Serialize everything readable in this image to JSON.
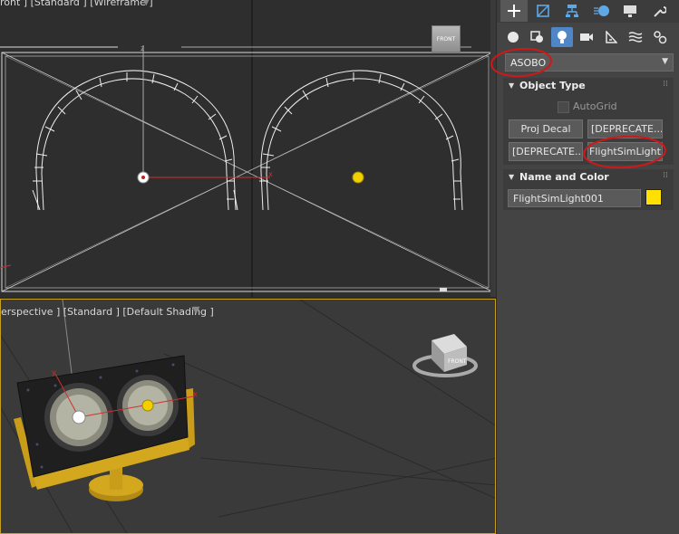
{
  "viewport_top": {
    "label": "ront ] [Standard ] [Wireframe ]",
    "viewcube_label": "FRONT"
  },
  "viewport_bottom": {
    "label": "erspective ] [Standard ] [Default Shading ]",
    "viewcube_label": "FRONT"
  },
  "command_panel": {
    "tabs": [
      "create-icon",
      "modify-icon",
      "hierarchy-icon",
      "motion-icon",
      "display-icon",
      "utilities-icon"
    ],
    "subcategories": [
      "geometry-icon",
      "shapes-icon",
      "lights-icon",
      "cameras-icon",
      "helpers-icon",
      "spacewarps-icon",
      "systems-icon"
    ],
    "category_dropdown": "ASOBO",
    "object_type": {
      "title": "Object Type",
      "autogrid_label": "AutoGrid",
      "buttons": [
        "Proj Decal",
        "[DEPRECATE...",
        "[DEPRECATE...",
        "FlightSimLight"
      ]
    },
    "name_and_color": {
      "title": "Name and Color",
      "name_value": "FlightSimLight001",
      "color": "#ffe000"
    }
  },
  "annotations": {
    "highlight_color": "#d01818"
  }
}
